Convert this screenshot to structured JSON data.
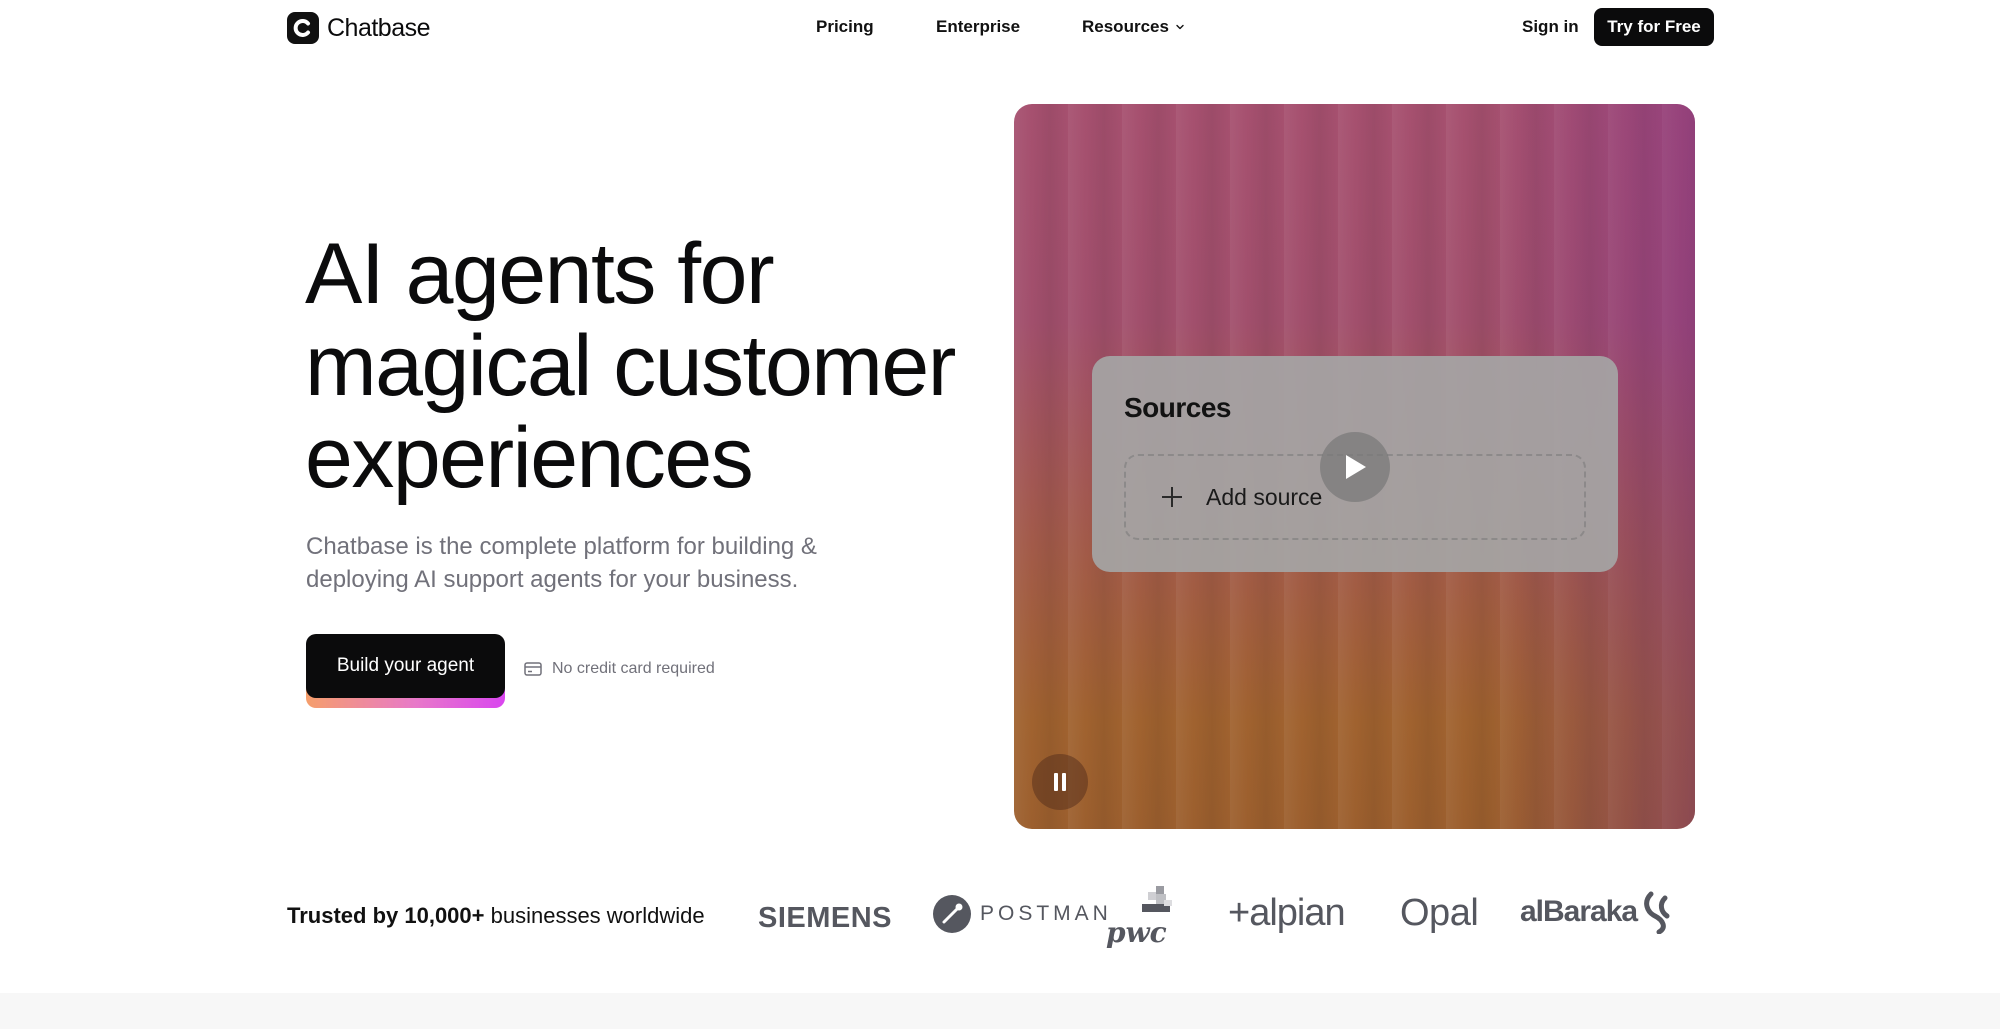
{
  "brand": {
    "name": "Chatbase"
  },
  "nav": {
    "links": [
      {
        "label": "Pricing"
      },
      {
        "label": "Enterprise"
      },
      {
        "label": "Resources"
      }
    ],
    "sign_in": "Sign in",
    "cta": "Try for Free"
  },
  "hero": {
    "title_line1": "AI agents for",
    "title_line2": "magical customer",
    "title_line3": "experiences",
    "subtitle_line1": "Chatbase is the complete platform for building &",
    "subtitle_line2": "deploying AI support agents for your business.",
    "cta": "Build your agent",
    "note": "No credit card required"
  },
  "video": {
    "card_title": "Sources",
    "add_source": "Add source",
    "play_icon": "play-icon",
    "pause_icon": "pause-icon"
  },
  "trusted": {
    "bold": "Trusted by 10,000+",
    "rest": " businesses worldwide",
    "logos": [
      "SIEMENS",
      "POSTMAN",
      "pwc",
      "+alpian",
      "Opal",
      "alBaraka"
    ]
  },
  "colors": {
    "primary": "#0b0b0c",
    "muted_text": "#71717a",
    "gradient_start": "#f59e6b",
    "gradient_end": "#d946ef"
  }
}
